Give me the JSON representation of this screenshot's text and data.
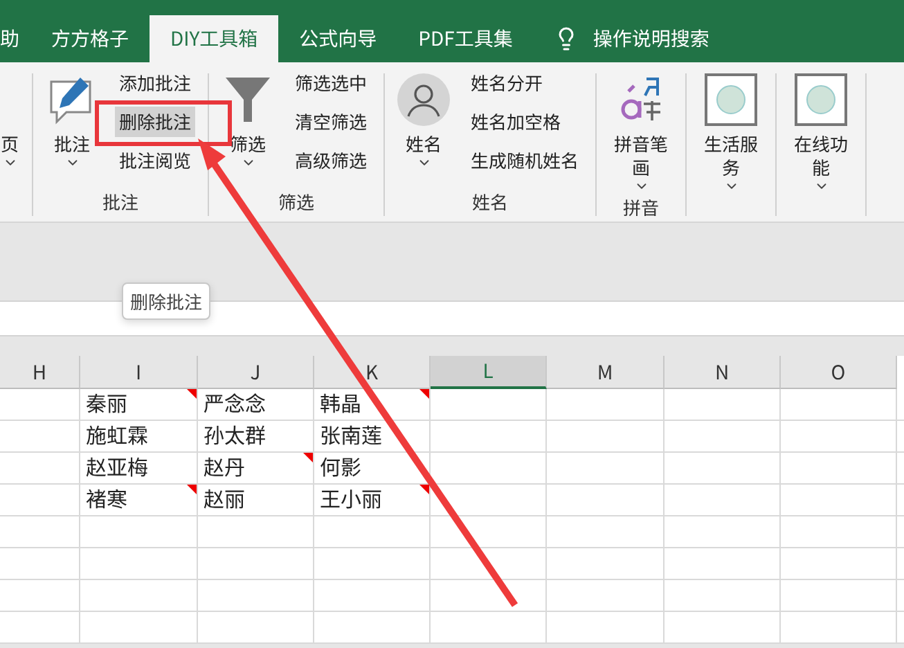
{
  "tabs": [
    {
      "label": "助",
      "selected": false
    },
    {
      "label": "方方格子",
      "selected": false
    },
    {
      "label": "DIY工具箱",
      "selected": true
    },
    {
      "label": "公式向导",
      "selected": false
    },
    {
      "label": "PDF工具集",
      "selected": false
    }
  ],
  "search": {
    "label": "操作说明搜索"
  },
  "ribbon": {
    "groups": [
      {
        "large": [
          {
            "label": "页",
            "caret": true
          }
        ]
      },
      {
        "label": "批注",
        "large": [
          {
            "label": "批注",
            "caret": true
          }
        ],
        "small": [
          {
            "label": "添加批注",
            "hovered": false
          },
          {
            "label": "删除批注",
            "hovered": true
          },
          {
            "label": "批注阅览",
            "hovered": false
          }
        ]
      },
      {
        "label": "筛选",
        "large": [
          {
            "label": "筛选",
            "caret": true
          }
        ],
        "small": [
          {
            "label": "筛选选中",
            "hovered": false
          },
          {
            "label": "清空筛选",
            "hovered": false
          },
          {
            "label": "高级筛选",
            "hovered": false
          }
        ]
      },
      {
        "label": "姓名",
        "large": [
          {
            "label": "姓名",
            "caret": true
          }
        ],
        "small": [
          {
            "label": "姓名分开",
            "hovered": false
          },
          {
            "label": "姓名加空格",
            "hovered": false
          },
          {
            "label": "生成随机姓名",
            "hovered": false
          }
        ]
      },
      {
        "label": "拼音",
        "large": [
          {
            "label": "拼音笔画",
            "caret": true
          }
        ]
      },
      {
        "large": [
          {
            "label": "生活服务",
            "caret": true
          }
        ]
      },
      {
        "large": [
          {
            "label": "在线功能",
            "caret": true
          }
        ]
      }
    ]
  },
  "tooltip": {
    "text": "删除批注"
  },
  "sheet": {
    "columns": [
      {
        "label": "H",
        "selected": false
      },
      {
        "label": "I",
        "selected": false
      },
      {
        "label": "J",
        "selected": false
      },
      {
        "label": "K",
        "selected": false
      },
      {
        "label": "L",
        "selected": true
      },
      {
        "label": "M",
        "selected": false
      },
      {
        "label": "N",
        "selected": false
      },
      {
        "label": "O",
        "selected": false
      }
    ],
    "rows": [
      [
        {
          "text": "秦丽",
          "comment": true
        },
        {
          "text": "严念念",
          "comment": false
        },
        {
          "text": "韩晶",
          "comment": true
        }
      ],
      [
        {
          "text": "施虹霖",
          "comment": false
        },
        {
          "text": "孙太群",
          "comment": false
        },
        {
          "text": "张南莲",
          "comment": false
        }
      ],
      [
        {
          "text": "赵亚梅",
          "comment": false
        },
        {
          "text": "赵丹",
          "comment": true
        },
        {
          "text": "何影",
          "comment": false
        }
      ],
      [
        {
          "text": "褚寒",
          "comment": true
        },
        {
          "text": "赵丽",
          "comment": false
        },
        {
          "text": "王小丽",
          "comment": true
        }
      ],
      [],
      [],
      [],
      []
    ]
  }
}
